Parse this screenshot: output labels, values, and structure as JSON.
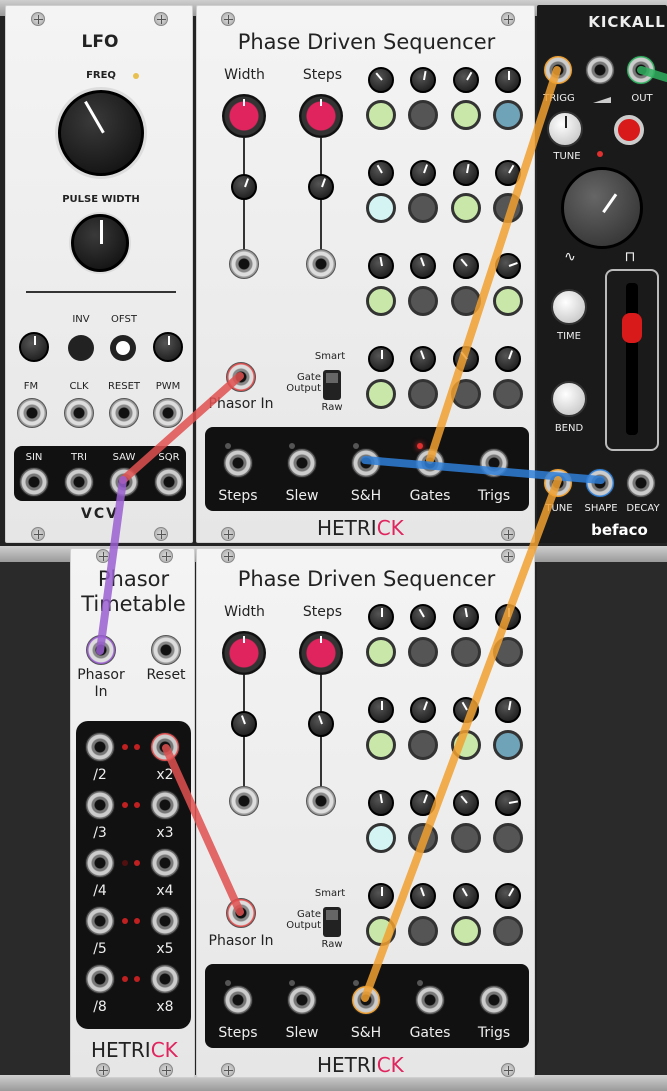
{
  "lfo": {
    "title": "LFO",
    "freq_label": "FREQ",
    "pulse_width_label": "PULSE WIDTH",
    "inv_label": "INV",
    "ofst_label": "OFST",
    "fm_label": "FM",
    "clk_label": "CLK",
    "reset_label": "RESET",
    "pwm_label": "PWM",
    "sin_label": "SIN",
    "tri_label": "TRI",
    "saw_label": "SAW",
    "sqr_label": "SQR",
    "brand": "VCV"
  },
  "seq1": {
    "title": "Phase Driven Sequencer",
    "width_label": "Width",
    "steps_label": "Steps",
    "smart_label": "Smart",
    "gate_output_label": "Gate\nOutput",
    "raw_label": "Raw",
    "phasor_in_label": "Phasor In",
    "outputs": [
      "Steps",
      "Slew",
      "S&H",
      "Gates",
      "Trigs"
    ],
    "brand_main": "HETRI",
    "brand_accent": "CK"
  },
  "kickall": {
    "title": "KICKALL",
    "trigg_label": "TRIGG",
    "out_label": "OUT",
    "tune_label": "TUNE",
    "time_label": "TIME",
    "bend_label": "BEND",
    "tune_in_label": "TUNE",
    "shape_label": "SHAPE",
    "decay_label": "DECAY",
    "brand": "befaco"
  },
  "phasor_timetable": {
    "title_line1": "Phasor",
    "title_line2": "Timetable",
    "phasor_in_label": "Phasor\nIn",
    "reset_label": "Reset",
    "left_labels": [
      "/2",
      "/3",
      "/4",
      "/5",
      "/8"
    ],
    "right_labels": [
      "x2",
      "x3",
      "x4",
      "x5",
      "x8"
    ],
    "brand_main": "HETRI",
    "brand_accent": "CK"
  },
  "seq2": {
    "title": "Phase Driven Sequencer",
    "width_label": "Width",
    "steps_label": "Steps",
    "smart_label": "Smart",
    "gate_output_label": "Gate\nOutput",
    "raw_label": "Raw",
    "phasor_in_label": "Phasor In",
    "outputs": [
      "Steps",
      "Slew",
      "S&H",
      "Gates",
      "Trigs"
    ],
    "brand_main": "HETRI",
    "brand_accent": "CK"
  },
  "colors": {
    "accent_pink": "#e0245e",
    "cable_orange": "#f0a030",
    "cable_red": "#e05050",
    "cable_purple": "#9a5fd0",
    "cable_blue": "#2f7fd8",
    "cable_green": "#30b060"
  }
}
